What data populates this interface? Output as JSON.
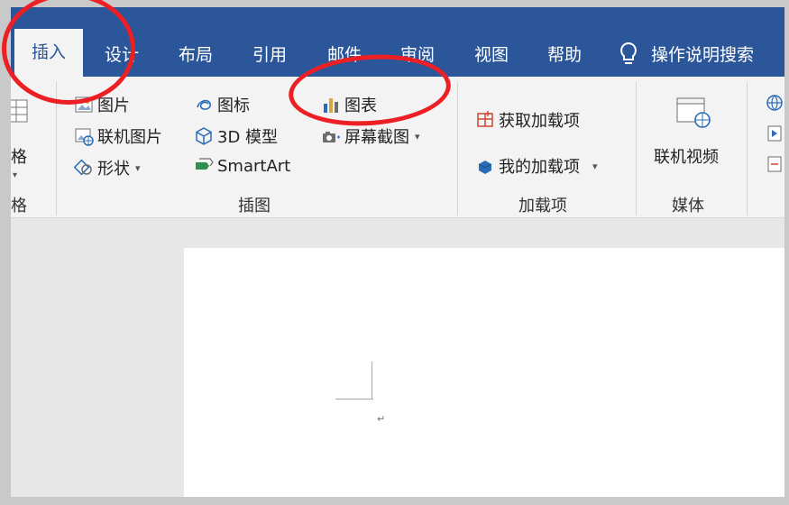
{
  "tabs": [
    {
      "label": "插入",
      "active": true
    },
    {
      "label": "设计"
    },
    {
      "label": "布局"
    },
    {
      "label": "引用"
    },
    {
      "label": "邮件"
    },
    {
      "label": "审阅"
    },
    {
      "label": "视图"
    },
    {
      "label": "帮助"
    }
  ],
  "tell_me": {
    "label": "操作说明搜索",
    "icon": "lightbulb-icon"
  },
  "table_group": {
    "button_label": "格",
    "label": "格"
  },
  "illustrations": {
    "label": "插图",
    "items": {
      "picture": "图片",
      "online_picture": "联机图片",
      "shapes": "形状",
      "icons": "图标",
      "model_3d": "3D 模型",
      "smartart": "SmartArt",
      "chart": "图表",
      "screenshot": "屏幕截图"
    }
  },
  "addins": {
    "label": "加载项",
    "get_addins": "获取加载项",
    "my_addins": "我的加载项"
  },
  "media": {
    "label": "媒体",
    "online_video": "联机视频"
  },
  "document": {
    "paragraph_mark": "↵"
  },
  "colors": {
    "ribbon_blue": "#2b579a",
    "annotation_red": "#ec1f24"
  }
}
